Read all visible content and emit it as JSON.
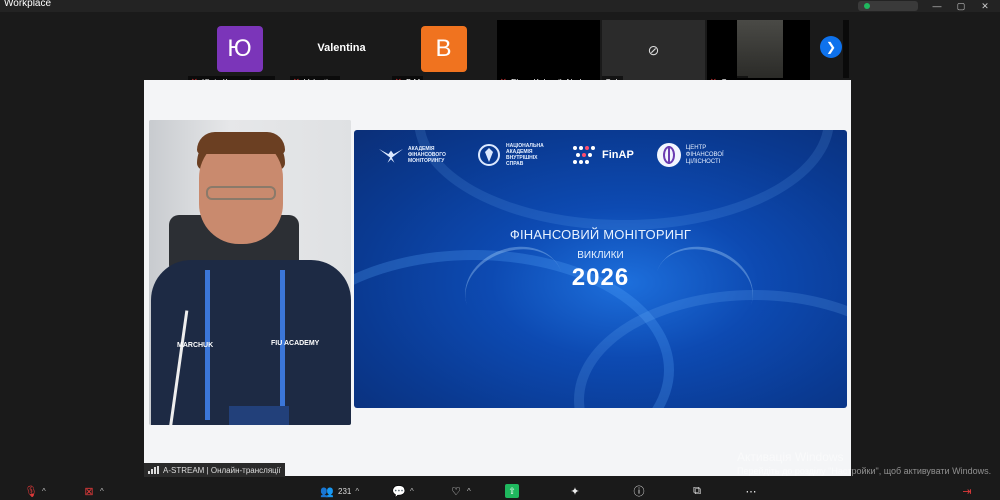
{
  "window": {
    "title": "Workplace"
  },
  "gallery": {
    "tiles": [
      {
        "type": "avatar",
        "initial": "Ю",
        "color": "#7b35b9",
        "name": "Юлія Ковернінська"
      },
      {
        "type": "name",
        "display": "Valentina",
        "name": "Valentina"
      },
      {
        "type": "avatar",
        "initial": "В",
        "color": "#f0731f",
        "name": "В М"
      },
      {
        "type": "video",
        "name": "Elena Kolesnik-Norka"
      },
      {
        "type": "video-off",
        "name": "Onb"
      },
      {
        "type": "video",
        "name": "Олена"
      }
    ]
  },
  "speaker": {
    "badge_left": "MARCHUK",
    "badge_right": "FIU ACADEMY"
  },
  "slide": {
    "logos": {
      "academy": "АКАДЕМІЯ ФІНАНСОВОГО МОНІТОРИНГУ",
      "naus": "НАЦІОНАЛЬНА АКАДЕМІЯ ВНУТРІШНІХ СПРАВ",
      "finap": "FinAP",
      "center": "ЦЕНТР ФІНАНСОВОЇ ЦІЛІСНОСТІ"
    },
    "title": "ФІНАНСОВИЙ МОНІТОРИНГ",
    "subtitle": "ВИКЛИКИ",
    "year": "2026"
  },
  "stream_tag": "A-STREAM | Онлайн-трансляції",
  "activation": {
    "title": "Активація Windows",
    "line": "Перейдіть до розділу \"Настройки\", щоб активувати Windows."
  },
  "toolbar": {
    "participants_count": "231"
  }
}
